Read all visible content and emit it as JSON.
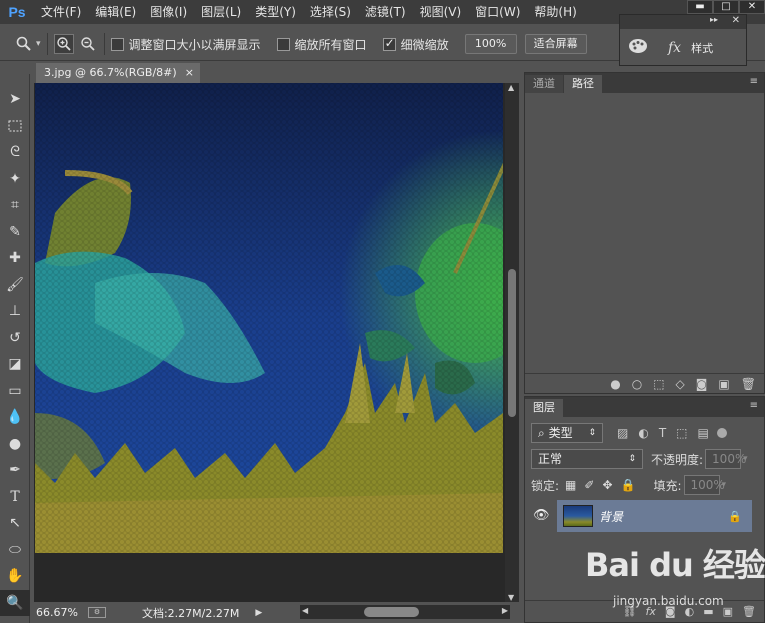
{
  "app": {
    "logo": "Ps"
  },
  "menubar": {
    "items": [
      "文件(F)",
      "编辑(E)",
      "图像(I)",
      "图层(L)",
      "类型(Y)",
      "选择(S)",
      "滤镜(T)",
      "视图(V)",
      "窗口(W)",
      "帮助(H)"
    ],
    "window_controls": {
      "minimize": "▬",
      "restore": "□",
      "close": "✕"
    }
  },
  "options": {
    "resize_window": "调整窗口大小以满屏显示",
    "zoom_all": "缩放所有窗口",
    "scrubby_zoom": "细微缩放",
    "zoom_value": "100%",
    "fit_screen": "适合屏幕",
    "scrubby_checked": true
  },
  "float_panel": {
    "label": "样式"
  },
  "document": {
    "tab_title": "3.jpg @ 66.7%(RGB/8#) *",
    "tab_close": "×",
    "zoom": "66.67%",
    "doc_info": "文档:2.27M/2.27M"
  },
  "paths_panel": {
    "tabs": [
      "通道",
      "路径"
    ],
    "active_tab": "路径"
  },
  "layers_panel": {
    "tab": "图层",
    "filter_kind": "类型",
    "blend_mode": "正常",
    "opacity_label": "不透明度:",
    "opacity_value": "100%",
    "lock_label": "锁定:",
    "fill_label": "填充:",
    "fill_value": "100%",
    "layers": [
      {
        "name": "背景",
        "visible": true,
        "locked": true
      }
    ]
  },
  "watermark": {
    "logo": "Bai du 经验",
    "url": "jingyan.baidu.com"
  }
}
